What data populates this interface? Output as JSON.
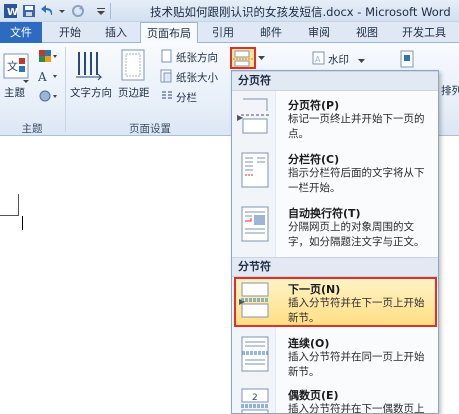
{
  "window": {
    "title": "技术贴如何跟刚认识的女孩发短信.docx - Microsoft Word"
  },
  "tabs": [
    {
      "label": "文件"
    },
    {
      "label": "开始"
    },
    {
      "label": "插入"
    },
    {
      "label": "页面布局"
    },
    {
      "label": "引用"
    },
    {
      "label": "邮件"
    },
    {
      "label": "审阅"
    },
    {
      "label": "视图"
    },
    {
      "label": "开发工具"
    }
  ],
  "ribbon": {
    "theme_label": "主题",
    "text_direction": "文字方向",
    "margins": "页边距",
    "orientation": "纸张方向",
    "size": "纸张大小",
    "columns": "分栏",
    "watermark": "水印",
    "arrange": "排列",
    "groups": {
      "theme": "主题",
      "page_setup": "页面设置"
    }
  },
  "breaks_menu": {
    "page_breaks_header": "分页符",
    "section_breaks_header": "分节符",
    "items": [
      {
        "title": "分页符(P)",
        "desc": "标记一页终止并开始下一页的点。"
      },
      {
        "title": "分栏符(C)",
        "desc": "指示分栏符后面的文字将从下一栏开始。"
      },
      {
        "title": "自动换行符(T)",
        "desc": "分隔网页上的对象周围的文字，如分隔题注文字与正文。"
      },
      {
        "title": "下一页(N)",
        "desc": "插入分节符并在下一页上开始新节。"
      },
      {
        "title": "连续(O)",
        "desc": "插入分节符并在同一页上开始新节。"
      },
      {
        "title": "偶数页(E)",
        "desc": "插入分节符并在下一偶数页上"
      }
    ]
  },
  "colors": {
    "file_tab": "#2c6bbf",
    "highlight_border": "#e0302a",
    "highlight_fill": "#ffe59a"
  }
}
